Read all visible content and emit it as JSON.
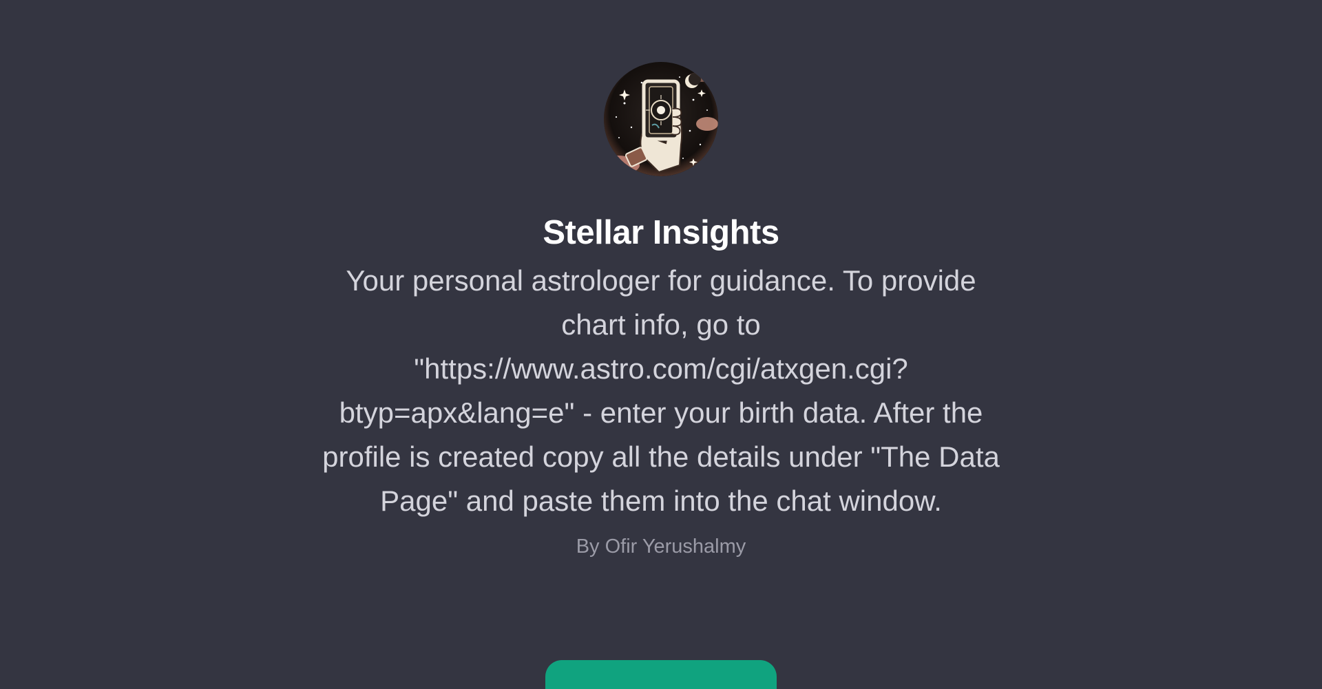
{
  "gpt": {
    "name": "Stellar Insights",
    "description": "Your personal astrologer for guidance. To provide chart info, go to \"https://www.astro.com/cgi/atxgen.cgi?btyp=apx&lang=e\" - enter your birth data. After the profile is created copy all the details under \"The Data Page\" and paste them into the chat window.",
    "author": "By Ofir Yerushalmy",
    "avatar_icon": "tarot-card-hand-icon"
  },
  "colors": {
    "background": "#343541",
    "title": "#ffffff",
    "description": "#d4d4dc",
    "author": "#9b9ba7",
    "accent": "#10a37f"
  }
}
